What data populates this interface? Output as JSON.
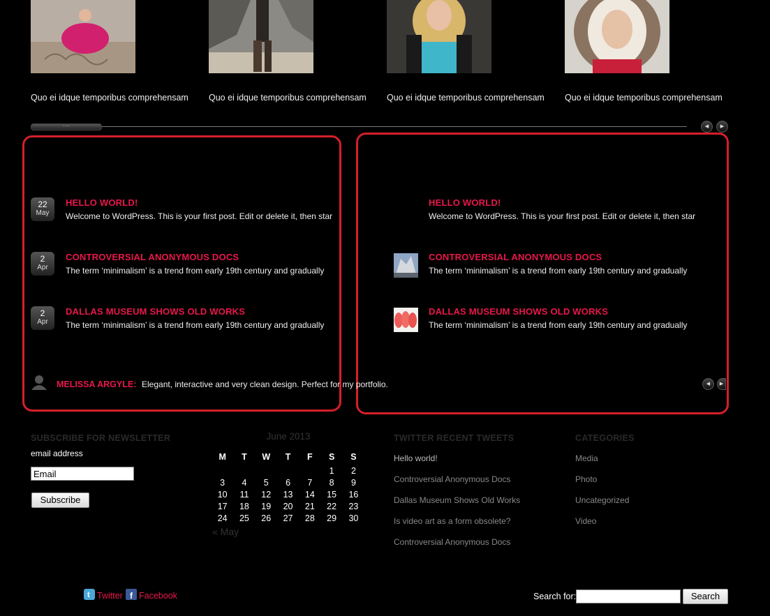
{
  "carousel": {
    "items": [
      {
        "caption": "Quo ei idque temporibus comprehensam"
      },
      {
        "caption": "Quo ei idque temporibus comprehensam"
      },
      {
        "caption": "Quo ei idque temporibus comprehensam"
      },
      {
        "caption": "Quo ei idque temporibus comprehensam"
      }
    ],
    "handle_label": "····"
  },
  "posts_left": [
    {
      "day": "22",
      "month": "May",
      "title": "HELLO WORLD!",
      "excerpt": "Welcome to WordPress. This is your first post. Edit or delete it, then star"
    },
    {
      "day": "2",
      "month": "Apr",
      "title": "CONTROVERSIAL ANONYMOUS DOCS",
      "excerpt": "The term ‘minimalism’ is a trend from early 19th century and gradually"
    },
    {
      "day": "2",
      "month": "Apr",
      "title": "DALLAS MUSEUM SHOWS OLD WORKS",
      "excerpt": "The term ‘minimalism’ is a trend from early 19th century and gradually"
    }
  ],
  "testimonial": {
    "author": "MELISSA ARGYLE:",
    "quote": "Elegant, interactive and very clean design. Perfect for my portfolio."
  },
  "posts_right": [
    {
      "title": "HELLO WORLD!",
      "excerpt": "Welcome to WordPress. This is your first post. Edit or delete it, then star"
    },
    {
      "title": "CONTROVERSIAL ANONYMOUS DOCS",
      "excerpt": "The term ‘minimalism’ is a trend from early 19th century and gradually"
    },
    {
      "title": "DALLAS MUSEUM SHOWS OLD WORKS",
      "excerpt": "The term ‘minimalism’ is a trend from early 19th century and gradually"
    }
  ],
  "newsletter": {
    "title": "SUBSCRIBE FOR NEWSLETTER",
    "label": "email address",
    "email_value": "Email",
    "button": "Subscribe"
  },
  "calendar": {
    "caption": "June 2013",
    "headers": [
      "M",
      "T",
      "W",
      "T",
      "F",
      "S",
      "S"
    ],
    "rows": [
      [
        "",
        "",
        "",
        "",
        "",
        "1",
        "2"
      ],
      [
        "3",
        "4",
        "5",
        "6",
        "7",
        "8",
        "9"
      ],
      [
        "10",
        "11",
        "12",
        "13",
        "14",
        "15",
        "16"
      ],
      [
        "17",
        "18",
        "19",
        "20",
        "21",
        "22",
        "23"
      ],
      [
        "24",
        "25",
        "26",
        "27",
        "28",
        "29",
        "30"
      ]
    ],
    "prev_link": "« May"
  },
  "tweets": {
    "title": "TWITTER RECENT TWEETS",
    "items": [
      "Hello world!",
      "Controversial Anonymous Docs",
      "Dallas Museum Shows Old Works",
      "Is video art as a form obsolete?",
      "Controversial Anonymous Docs"
    ]
  },
  "categories": {
    "title": "CATEGORIES",
    "items": [
      "Media",
      "Photo",
      "Uncategorized",
      "Video"
    ]
  },
  "footer": {
    "twitter": "Twitter",
    "facebook": "Facebook",
    "search_label": "Search for:",
    "search_value": "",
    "search_button": "Search"
  },
  "colors": {
    "accent": "#e8174b",
    "highlight_box": "#d41f2a",
    "background": "#000000"
  }
}
